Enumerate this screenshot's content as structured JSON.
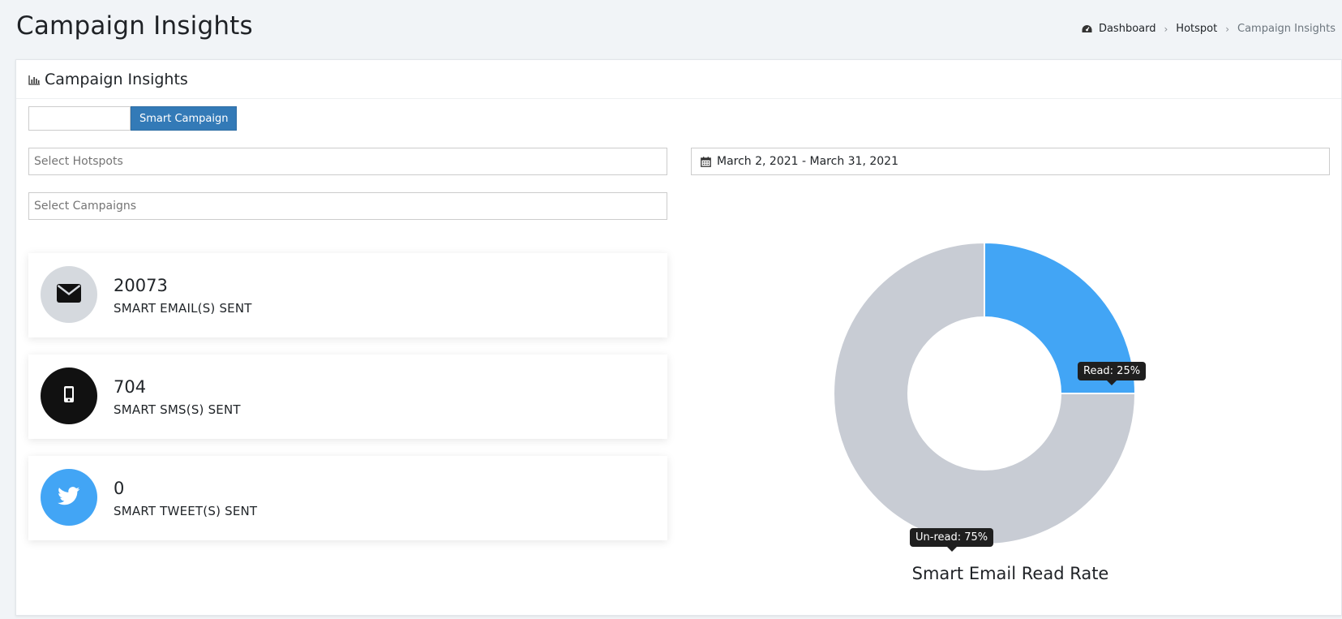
{
  "page": {
    "title": "Campaign Insights"
  },
  "breadcrumb": {
    "items": [
      "Dashboard",
      "Hotspot",
      "Campaign Insights"
    ]
  },
  "card": {
    "title": "Campaign Insights"
  },
  "tabs": {
    "active_label": "Smart Campaign"
  },
  "filters": {
    "hotspots_placeholder": "Select Hotspots",
    "campaigns_placeholder": "Select Campaigns",
    "date_range": "March 2, 2021 - March 31, 2021"
  },
  "stats": [
    {
      "value": "20073",
      "label": "SMART EMAIL(S) SENT",
      "icon": "envelope-icon",
      "circle_color": "#d5d9de",
      "icon_color": "#111111"
    },
    {
      "value": "704",
      "label": "SMART SMS(S) SENT",
      "icon": "mobile-icon",
      "circle_color": "#111111",
      "icon_color": "#ffffff"
    },
    {
      "value": "0",
      "label": "SMART TWEET(S) SENT",
      "icon": "twitter-icon",
      "circle_color": "#42a5f5",
      "icon_color": "#ffffff"
    }
  ],
  "chart_data": {
    "type": "pie",
    "title": "Smart Email Read Rate",
    "slices": [
      {
        "name": "Read",
        "value": 25,
        "color": "#42a5f5",
        "tooltip": "Read: 25%"
      },
      {
        "name": "Un-read",
        "value": 75,
        "color": "#c8ccd4",
        "tooltip": "Un-read: 75%"
      }
    ]
  }
}
